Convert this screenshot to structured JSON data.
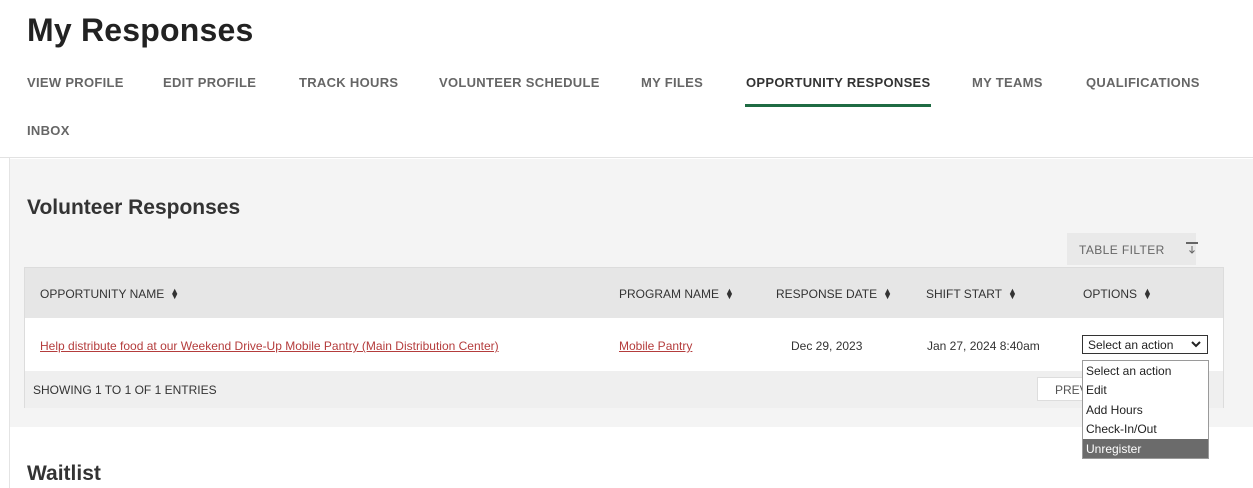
{
  "page": {
    "title": "My Responses"
  },
  "nav": {
    "tabs": [
      {
        "label": "VIEW PROFILE"
      },
      {
        "label": "EDIT PROFILE"
      },
      {
        "label": "TRACK HOURS"
      },
      {
        "label": "VOLUNTEER SCHEDULE"
      },
      {
        "label": "MY FILES"
      },
      {
        "label": "OPPORTUNITY RESPONSES"
      },
      {
        "label": "MY TEAMS"
      },
      {
        "label": "QUALIFICATIONS"
      },
      {
        "label": "INBOX"
      }
    ],
    "active_tab": "OPPORTUNITY RESPONSES"
  },
  "volunteer_responses": {
    "title": "Volunteer Responses",
    "filter_label": "TABLE FILTER",
    "columns": [
      "OPPORTUNITY NAME",
      "PROGRAM NAME",
      "RESPONSE DATE",
      "SHIFT START",
      "OPTIONS"
    ],
    "rows": [
      {
        "opportunity": "Help distribute food at our Weekend Drive-Up Mobile Pantry (Main Distribution Center)",
        "program": "Mobile Pantry",
        "response_date": "Dec 29, 2023",
        "shift_start": "Jan 27, 2024 8:40am",
        "action_value": "Select an action"
      }
    ],
    "showing": "SHOWING 1 TO 1 OF 1 ENTRIES",
    "prev_label": "PREV",
    "action_options": [
      "Select an action",
      "Edit",
      "Add Hours",
      "Check-In/Out",
      "Unregister"
    ],
    "highlighted_option": "Unregister"
  },
  "waitlist": {
    "title": "Waitlist"
  },
  "colors": {
    "accent": "#1f6b43",
    "link": "#b43c3c",
    "highlight": "#6b6b6b"
  },
  "icons": {
    "filter": "filter-icon",
    "sort": "sort-icon",
    "dropdown": "chevron-down-icon"
  }
}
